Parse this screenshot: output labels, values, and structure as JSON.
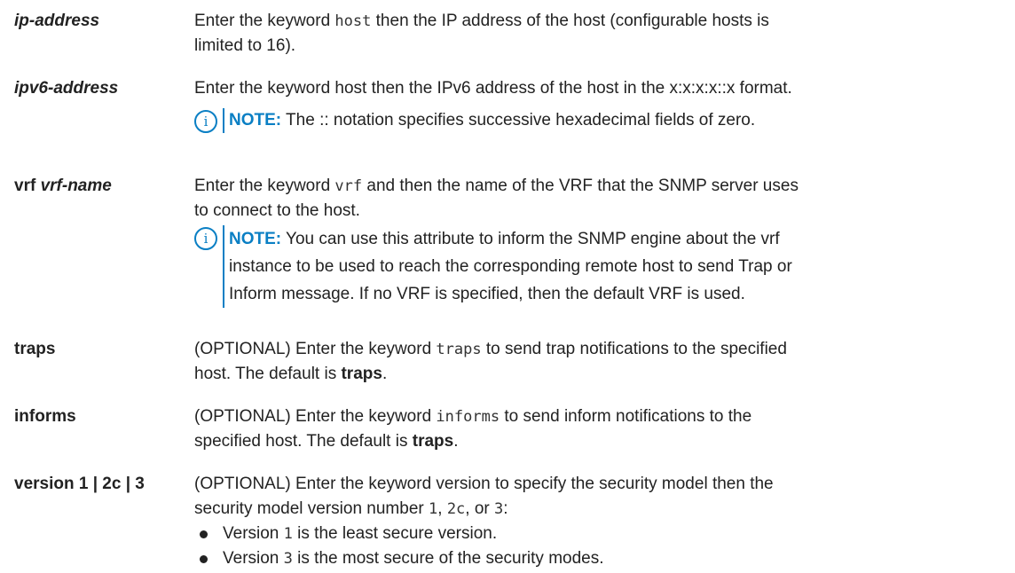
{
  "rows": [
    {
      "term": {
        "a": "",
        "b": "ip-address"
      },
      "lines": [
        {
          "t1": "Enter the keyword ",
          "m1": "host",
          "t2": " then the IP address of the host (configurable hosts is"
        },
        {
          "t1": "limited to 16)."
        }
      ]
    },
    {
      "term": {
        "a": "",
        "b": "ipv6-address"
      },
      "lines": [
        {
          "t1": "Enter the keyword host then the IPv6 address of the host in the x:x:x:x::x format."
        }
      ],
      "note": {
        "label": "NOTE:",
        "lines": [
          " The :: notation specifies successive hexadecimal fields of zero."
        ]
      }
    },
    {
      "term": {
        "a": "vrf ",
        "b": "vrf-name"
      },
      "lines": [
        {
          "t1": "Enter the keyword ",
          "m1": "vrf",
          "t2": " and then the name of the VRF that the SNMP server uses"
        },
        {
          "t1": "to connect to the host."
        }
      ],
      "note": {
        "label": "NOTE:",
        "lines": [
          " You can use this attribute to inform the SNMP engine about the vrf",
          "instance to be used to reach the corresponding remote host to send Trap or",
          "Inform message. If no VRF is specified, then the default VRF is used."
        ]
      }
    },
    {
      "term": {
        "a": "traps",
        "b": ""
      },
      "lines": [
        {
          "t1": "(OPTIONAL) Enter the keyword ",
          "m1": "traps",
          "t2": " to send trap notifications to the specified"
        },
        {
          "t1": "host. The default is ",
          "b1": "traps",
          "t2": "."
        }
      ]
    },
    {
      "term": {
        "a": "informs",
        "b": ""
      },
      "lines": [
        {
          "t1": "(OPTIONAL) Enter the keyword ",
          "m1": "informs",
          "t2": " to send inform notifications to the"
        },
        {
          "t1": "specified host. The default is ",
          "b1": "traps",
          "t2": "."
        }
      ]
    },
    {
      "term": {
        "a": "version 1 | 2c | 3",
        "b": ""
      },
      "lines": [
        {
          "t1": "(OPTIONAL) Enter the keyword version to specify the security model then the"
        },
        {
          "t1": "security model version number ",
          "m1": "1",
          "t2": ", ",
          "m2": "2c",
          "t3": ", or ",
          "m3": "3",
          "t4": ":"
        }
      ],
      "bullets": [
        {
          "t1": "Version ",
          "m1": "1",
          "t2": " is the least secure version."
        },
        {
          "t1": "Version ",
          "m1": "3",
          "t2": " is the most secure of the security modes."
        }
      ]
    }
  ],
  "colors": {
    "text": "#222222",
    "note_accent": "#0a7fc4"
  },
  "icons": {
    "note": "info-circle-icon"
  },
  "note_icon_glyph": "i"
}
